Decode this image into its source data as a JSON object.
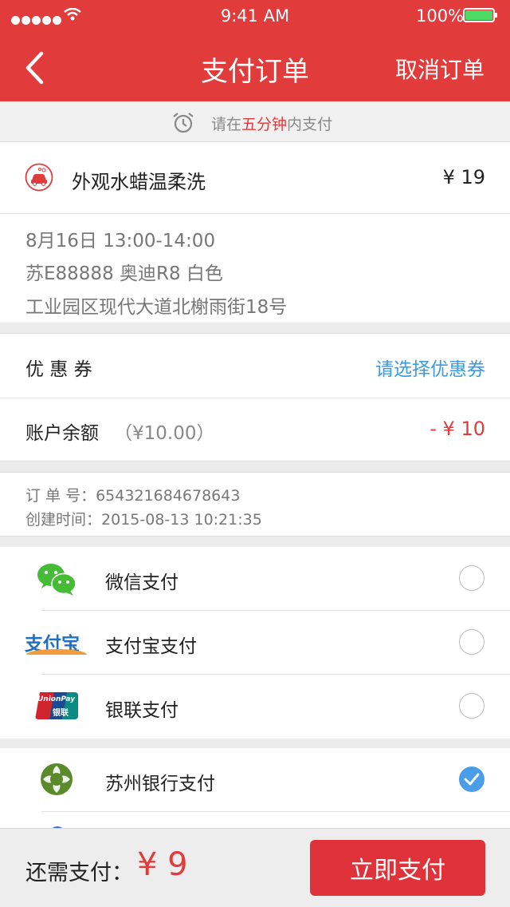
{
  "status_bar": {
    "time": "9:41 AM",
    "battery": "100%"
  },
  "nav": {
    "title": "支付订单",
    "right": "取消订单"
  },
  "timer_banner": {
    "prefix": "请在",
    "highlight": "五分钟",
    "suffix": "内支付"
  },
  "service": {
    "name": "外观水蜡温柔洗",
    "price": "¥ 19"
  },
  "order_details": {
    "datetime": "8月16日  13:00-14:00",
    "car": "苏E88888  奥迪R8  白色",
    "address": "工业园区现代大道北榭雨街18号"
  },
  "coupon": {
    "label": "优 惠 券",
    "action": "请选择优惠券"
  },
  "balance": {
    "label": "账户余额",
    "amount": "（¥10.00）",
    "deduct": "- ¥ 10"
  },
  "order_info": {
    "order_no_label": "订 单  号：",
    "order_no": "654321684678643",
    "created_label": "创建时间：",
    "created": "2015-08-13  10:21:35"
  },
  "payment_methods": [
    {
      "label": "微信支付",
      "icon": "wechat-icon",
      "selected": false
    },
    {
      "label": "支付宝支付",
      "icon": "alipay-icon",
      "selected": false
    },
    {
      "label": "银联支付",
      "icon": "unionpay-icon",
      "selected": false
    },
    {
      "label": "苏州银行支付",
      "icon": "bank-of-suzhou-icon",
      "selected": true
    }
  ],
  "icon_texts": {
    "alipay": "支付宝",
    "unionpay_top": "UnionPay",
    "unionpay_bottom": "银联"
  },
  "footer": {
    "label": "还需支付：",
    "amount": "¥ 9",
    "button": "立即支付"
  },
  "colors": {
    "primary": "#e23b3b",
    "link": "#3a9be3",
    "check": "#4a9de8"
  }
}
